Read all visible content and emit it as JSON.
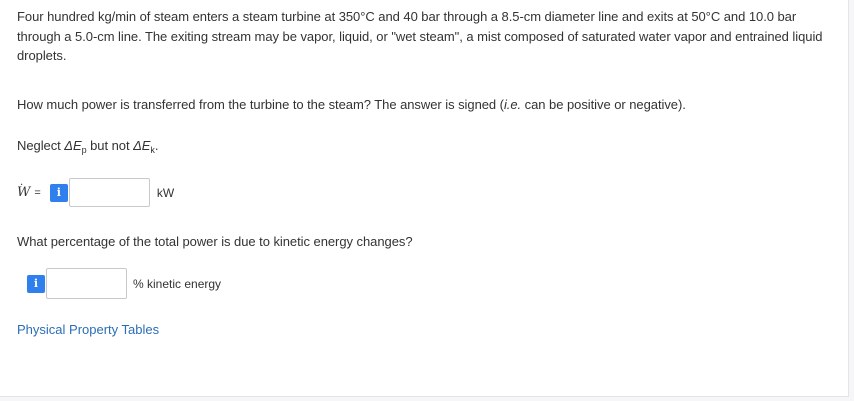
{
  "problem": {
    "statement": "Four hundred kg/min of steam enters a steam turbine at 350°C and 40 bar through a 8.5-cm diameter line and exits at 50°C and 10.0 bar through a 5.0-cm line. The exiting stream may be vapor, liquid, or \"wet steam\", a mist composed of saturated water vapor and entrained liquid droplets.",
    "question1_text": "How much power is transferred from the turbine to the steam? The answer is signed (",
    "question1_ie": "i.e.",
    "question1_end": " can be positive or negative).",
    "neglect_prefix": "Neglect ",
    "neglect_ep_sym": "ΔE",
    "neglect_ep_sub": "p",
    "neglect_middle": " but not ",
    "neglect_ek_sym": "ΔE",
    "neglect_ek_sub": "k",
    "neglect_end": "."
  },
  "answer1": {
    "label": "W",
    "dot": "·",
    "equals": "=",
    "info_glyph": "i",
    "value": "",
    "unit": "kW"
  },
  "question2": {
    "text": "What percentage of the total power is due to kinetic energy changes?"
  },
  "answer2": {
    "info_glyph": "i",
    "value": "",
    "unit": "% kinetic energy"
  },
  "link": {
    "label": "Physical Property Tables"
  },
  "colors": {
    "accent": "#2f80ed",
    "link": "#2a6eb8",
    "text": "#333333"
  }
}
